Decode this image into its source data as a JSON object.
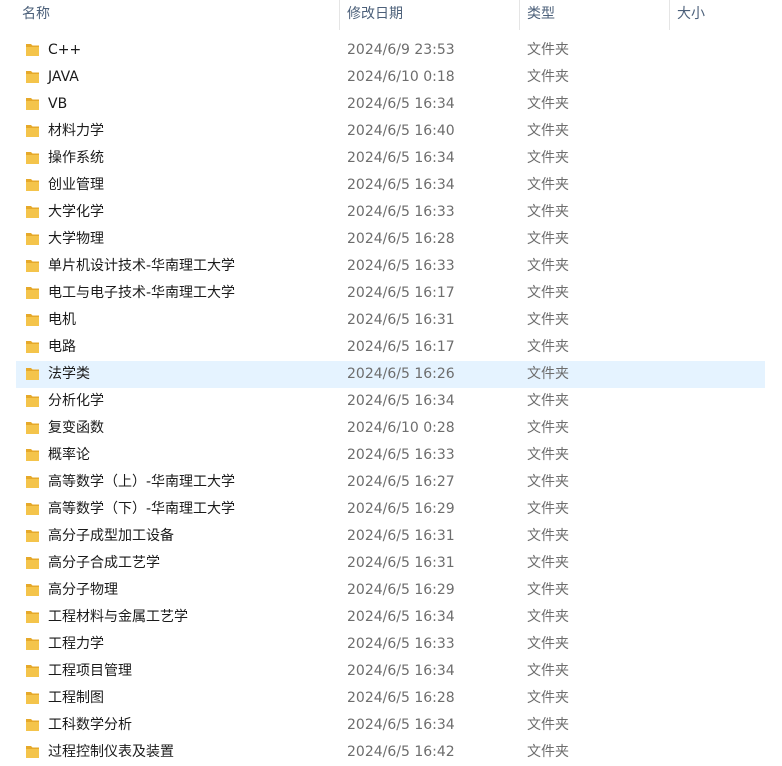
{
  "header": {
    "name_label": "名称",
    "modified_label": "修改日期",
    "type_label": "类型",
    "size_label": "大小",
    "sort_indicator": "^"
  },
  "colors": {
    "folder": "#f4c44b",
    "folder_back": "#e6a92a",
    "selected_row": "#e5f3ff"
  },
  "files": [
    {
      "name": "C++",
      "modified": "2024/6/9 23:53",
      "type": "文件夹",
      "size": "",
      "icon": "folder-icon"
    },
    {
      "name": "JAVA",
      "modified": "2024/6/10 0:18",
      "type": "文件夹",
      "size": "",
      "icon": "folder-icon"
    },
    {
      "name": "VB",
      "modified": "2024/6/5 16:34",
      "type": "文件夹",
      "size": "",
      "icon": "folder-icon"
    },
    {
      "name": "材料力学",
      "modified": "2024/6/5 16:40",
      "type": "文件夹",
      "size": "",
      "icon": "folder-icon"
    },
    {
      "name": "操作系统",
      "modified": "2024/6/5 16:34",
      "type": "文件夹",
      "size": "",
      "icon": "folder-icon"
    },
    {
      "name": "创业管理",
      "modified": "2024/6/5 16:34",
      "type": "文件夹",
      "size": "",
      "icon": "folder-icon"
    },
    {
      "name": "大学化学",
      "modified": "2024/6/5 16:33",
      "type": "文件夹",
      "size": "",
      "icon": "folder-icon"
    },
    {
      "name": "大学物理",
      "modified": "2024/6/5 16:28",
      "type": "文件夹",
      "size": "",
      "icon": "folder-icon"
    },
    {
      "name": "单片机设计技术-华南理工大学",
      "modified": "2024/6/5 16:33",
      "type": "文件夹",
      "size": "",
      "icon": "folder-icon"
    },
    {
      "name": "电工与电子技术-华南理工大学",
      "modified": "2024/6/5 16:17",
      "type": "文件夹",
      "size": "",
      "icon": "folder-icon"
    },
    {
      "name": "电机",
      "modified": "2024/6/5 16:31",
      "type": "文件夹",
      "size": "",
      "icon": "folder-icon"
    },
    {
      "name": "电路",
      "modified": "2024/6/5 16:17",
      "type": "文件夹",
      "size": "",
      "icon": "folder-icon"
    },
    {
      "name": "法学类",
      "modified": "2024/6/5 16:26",
      "type": "文件夹",
      "size": "",
      "icon": "folder-icon",
      "selected": true
    },
    {
      "name": "分析化学",
      "modified": "2024/6/5 16:34",
      "type": "文件夹",
      "size": "",
      "icon": "folder-icon"
    },
    {
      "name": "复变函数",
      "modified": "2024/6/10 0:28",
      "type": "文件夹",
      "size": "",
      "icon": "folder-icon"
    },
    {
      "name": "概率论",
      "modified": "2024/6/5 16:33",
      "type": "文件夹",
      "size": "",
      "icon": "folder-icon"
    },
    {
      "name": "高等数学（上）-华南理工大学",
      "modified": "2024/6/5 16:27",
      "type": "文件夹",
      "size": "",
      "icon": "folder-icon"
    },
    {
      "name": "高等数学（下）-华南理工大学",
      "modified": "2024/6/5 16:29",
      "type": "文件夹",
      "size": "",
      "icon": "folder-icon"
    },
    {
      "name": "高分子成型加工设备",
      "modified": "2024/6/5 16:31",
      "type": "文件夹",
      "size": "",
      "icon": "folder-icon"
    },
    {
      "name": "高分子合成工艺学",
      "modified": "2024/6/5 16:31",
      "type": "文件夹",
      "size": "",
      "icon": "folder-icon"
    },
    {
      "name": "高分子物理",
      "modified": "2024/6/5 16:29",
      "type": "文件夹",
      "size": "",
      "icon": "folder-icon"
    },
    {
      "name": "工程材料与金属工艺学",
      "modified": "2024/6/5 16:34",
      "type": "文件夹",
      "size": "",
      "icon": "folder-icon"
    },
    {
      "name": "工程力学",
      "modified": "2024/6/5 16:33",
      "type": "文件夹",
      "size": "",
      "icon": "folder-icon"
    },
    {
      "name": "工程项目管理",
      "modified": "2024/6/5 16:34",
      "type": "文件夹",
      "size": "",
      "icon": "folder-icon"
    },
    {
      "name": "工程制图",
      "modified": "2024/6/5 16:28",
      "type": "文件夹",
      "size": "",
      "icon": "folder-icon"
    },
    {
      "name": "工科数学分析",
      "modified": "2024/6/5 16:34",
      "type": "文件夹",
      "size": "",
      "icon": "folder-icon"
    },
    {
      "name": "过程控制仪表及装置",
      "modified": "2024/6/5 16:42",
      "type": "文件夹",
      "size": "",
      "icon": "folder-icon"
    }
  ]
}
